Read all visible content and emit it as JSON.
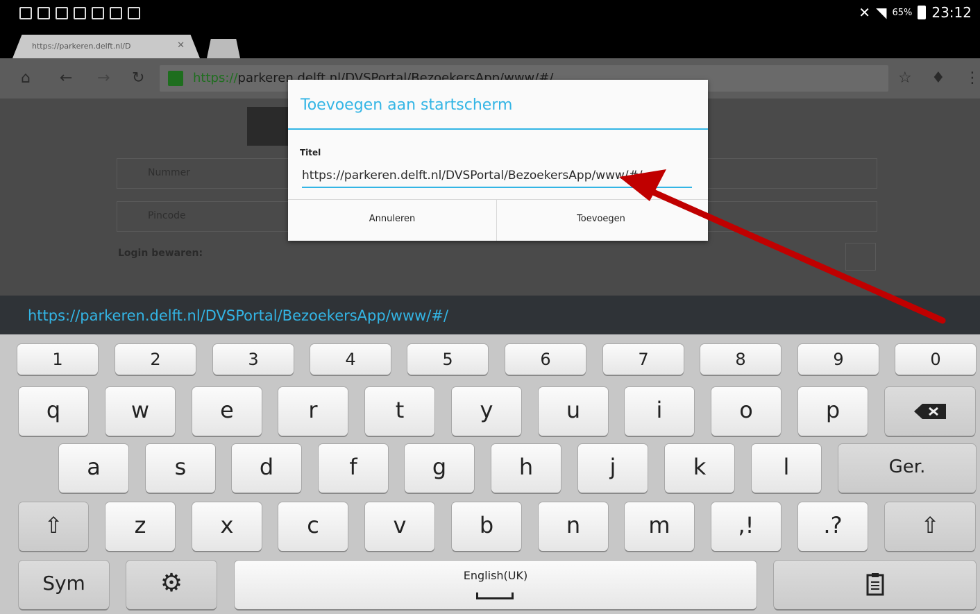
{
  "statusbar": {
    "battery_pct": "65%",
    "time": "23:12"
  },
  "browser": {
    "tab_title": "https://parkeren.delft.nl/D",
    "url_scheme": "https://",
    "url_rest": "parkeren.delft.nl/DVSPortal/BezoekersApp/www/#/"
  },
  "page": {
    "field_number_placeholder": "Nummer",
    "field_pin_placeholder": "Pincode",
    "login_save_label": "Login bewaren:"
  },
  "dialog": {
    "title": "Toevoegen aan startscherm",
    "field_label": "Titel",
    "field_value": "https://parkeren.delft.nl/DVSPortal/BezoekersApp/www/#/",
    "cancel_label": "Annuleren",
    "add_label": "Toevoegen"
  },
  "suggestion": "https://parkeren.delft.nl/DVSPortal/BezoekersApp/www/#/",
  "keyboard": {
    "numbers": [
      "1",
      "2",
      "3",
      "4",
      "5",
      "6",
      "7",
      "8",
      "9",
      "0"
    ],
    "row2": [
      "q",
      "w",
      "e",
      "r",
      "t",
      "y",
      "u",
      "i",
      "o",
      "p"
    ],
    "row3": [
      "a",
      "s",
      "d",
      "f",
      "g",
      "h",
      "j",
      "k",
      "l"
    ],
    "row4": [
      "z",
      "x",
      "c",
      "v",
      "b",
      "n",
      "m"
    ],
    "comma_key": ",!",
    "period_key": ".?",
    "enter_label": "Ger.",
    "sym_label": "Sym",
    "space_language": "English(UK)",
    "shift_glyph": "⇧",
    "backspace_icon": "backspace-icon",
    "settings_icon": "gear-icon",
    "clipboard_icon": "clipboard-icon"
  },
  "annotation": {
    "arrow_color": "#c00000"
  }
}
